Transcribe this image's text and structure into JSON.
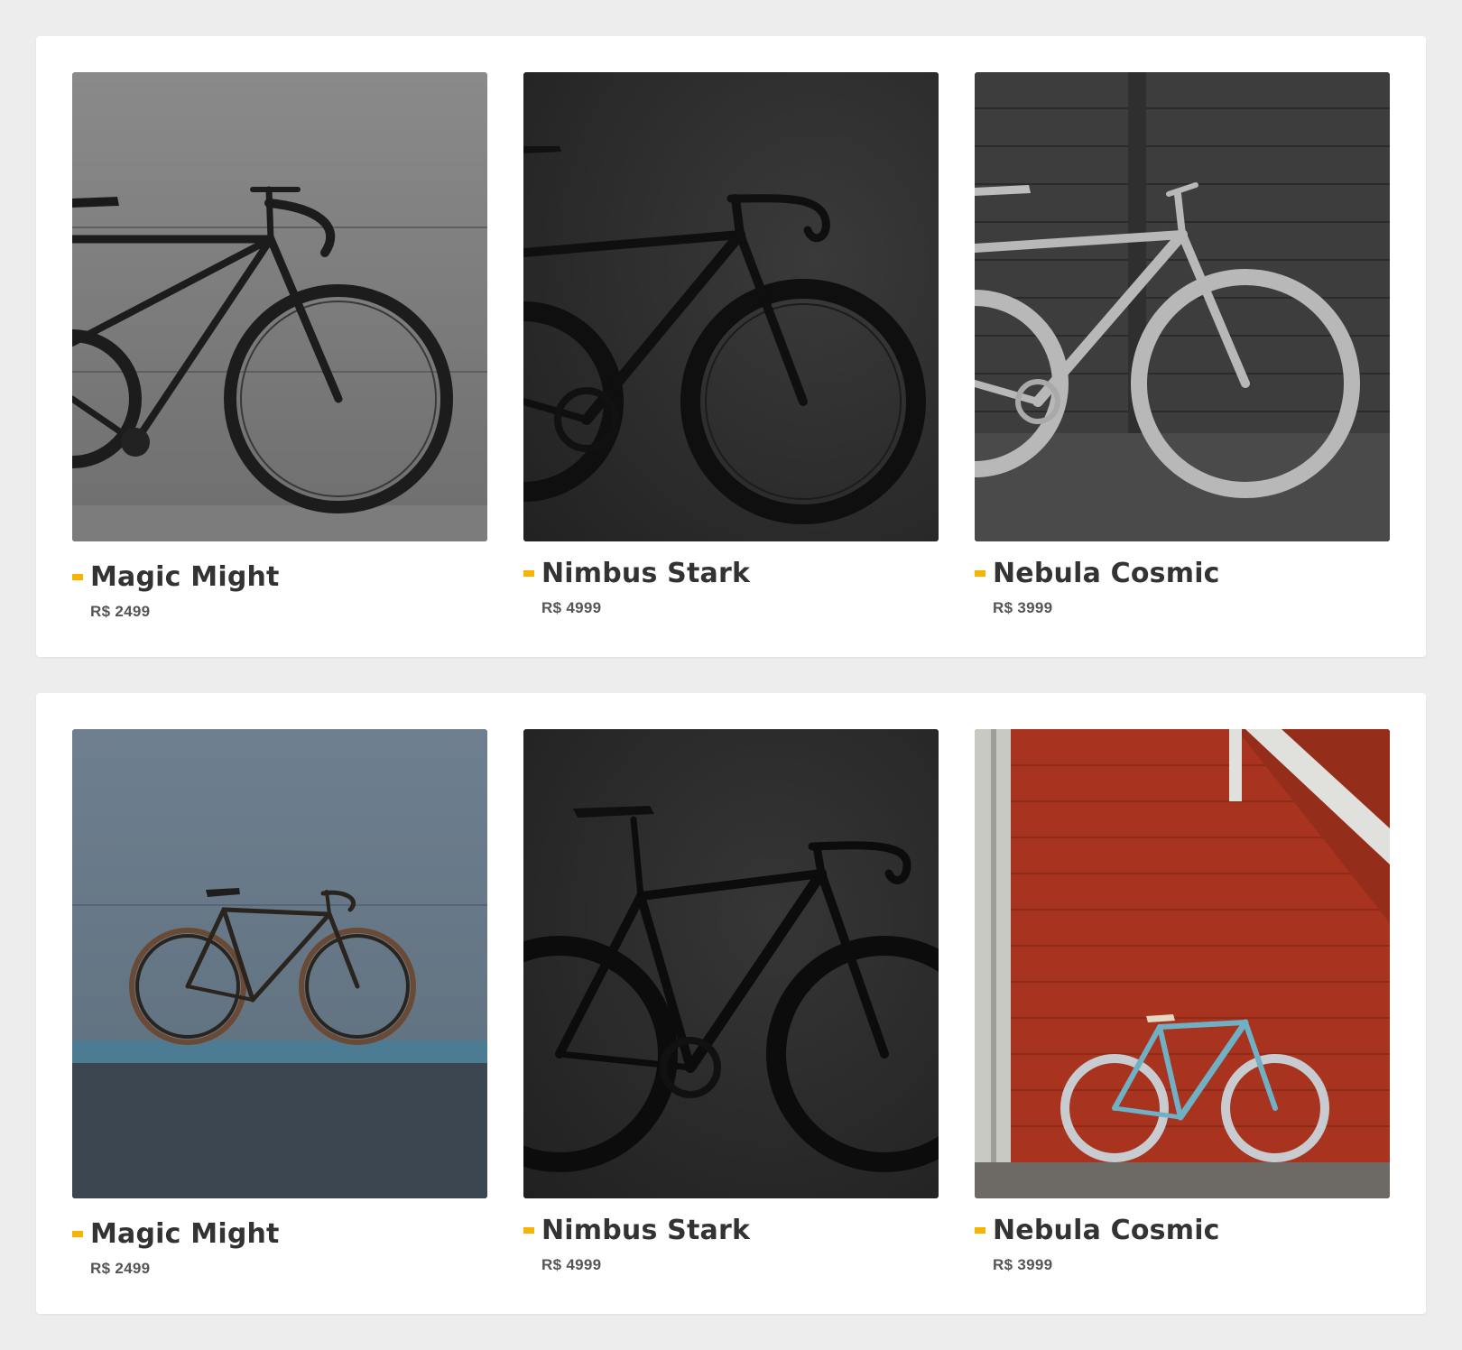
{
  "sections": [
    {
      "products": [
        {
          "name": "Magic Might",
          "price": "R$ 2499",
          "image": "bike-photo-concrete-wall-black-fixie"
        },
        {
          "name": "Nimbus Stark",
          "price": "R$ 4999",
          "image": "bike-photo-dark-studio-road-bike"
        },
        {
          "name": "Nebula Cosmic",
          "price": "R$ 3999",
          "image": "bike-photo-wood-wall-white-bike"
        }
      ]
    },
    {
      "products": [
        {
          "name": "Magic Might",
          "price": "R$ 2499",
          "image": "bike-photo-blue-wall-fixie"
        },
        {
          "name": "Nimbus Stark",
          "price": "R$ 4999",
          "image": "bike-photo-dark-studio-road-bike"
        },
        {
          "name": "Nebula Cosmic",
          "price": "R$ 3999",
          "image": "bike-photo-red-wall-teal-bike"
        }
      ]
    }
  ],
  "colors": {
    "page_background": "#ededed",
    "panel_background": "#ffffff",
    "accent_marker": "#f5b400",
    "title_text": "#333333",
    "price_text": "#555555"
  }
}
